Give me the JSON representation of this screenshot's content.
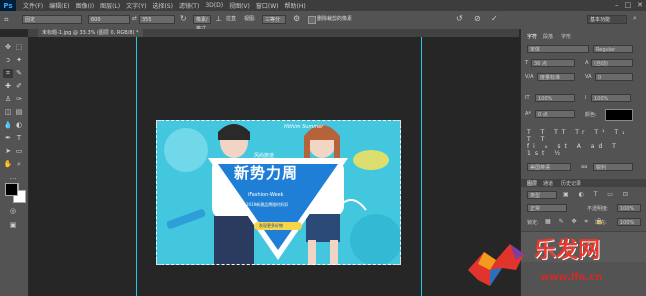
{
  "app": {
    "logo": "Ps"
  },
  "menubar": {
    "items": [
      "文件(F)",
      "编辑(E)",
      "图像(I)",
      "图层(L)",
      "文字(Y)",
      "选择(S)",
      "滤镜(T)",
      "3D(D)",
      "视图(V)",
      "窗口(W)",
      "帮助(H)"
    ]
  },
  "window": {
    "minimize": "–",
    "restore": "□",
    "close": "✕"
  },
  "options": {
    "style_value": "固定",
    "width_value": "600",
    "height_value": "355",
    "resolution_label": "像素/英寸",
    "straighten_label": "拉直",
    "view_label": "视图:",
    "view_value": "三等分",
    "delete_cropped_label": "删除裁剪的像素",
    "workspace_value": "基本功能"
  },
  "document_tab": {
    "label": "未标题-1.jpg @ 33.3% (图层 0, RGB/8) *"
  },
  "artwork": {
    "subtitle_top": "风尚旅途",
    "main_title": "新势力周",
    "english_title": "iFashion-Week",
    "script_text": "Hithim Summer",
    "promo_text": "2019新潮品牌限时折扣",
    "button_text": "发现更多好物"
  },
  "panels": {
    "char_tabs": [
      "字符",
      "段落",
      "字形"
    ],
    "font_value": "宋体",
    "style_value": "Regular",
    "size_value": "36 点",
    "leading_value": "(自动)",
    "tracking_value": "0",
    "kerning_value": "度量标准",
    "scale_v": "100%",
    "scale_h": "100%",
    "baseline_value": "0 点",
    "color_label": "颜色:",
    "lang_value": "美国英语",
    "aa_value": "锐利",
    "layer_tabs": [
      "图层",
      "通道",
      "历史记录"
    ],
    "kind_value": "类型",
    "blend_value": "正常",
    "opacity_label": "不透明度:",
    "opacity_value": "100%",
    "lock_label": "锁定:",
    "fill_label": "填充:",
    "fill_value": "100%"
  },
  "watermark": {
    "brand": "乐发网",
    "url": "www.lfe.cn"
  },
  "colors": {
    "accent": "#2fc4e6",
    "banner": "#43c7df",
    "ui_bg": "#535353"
  }
}
